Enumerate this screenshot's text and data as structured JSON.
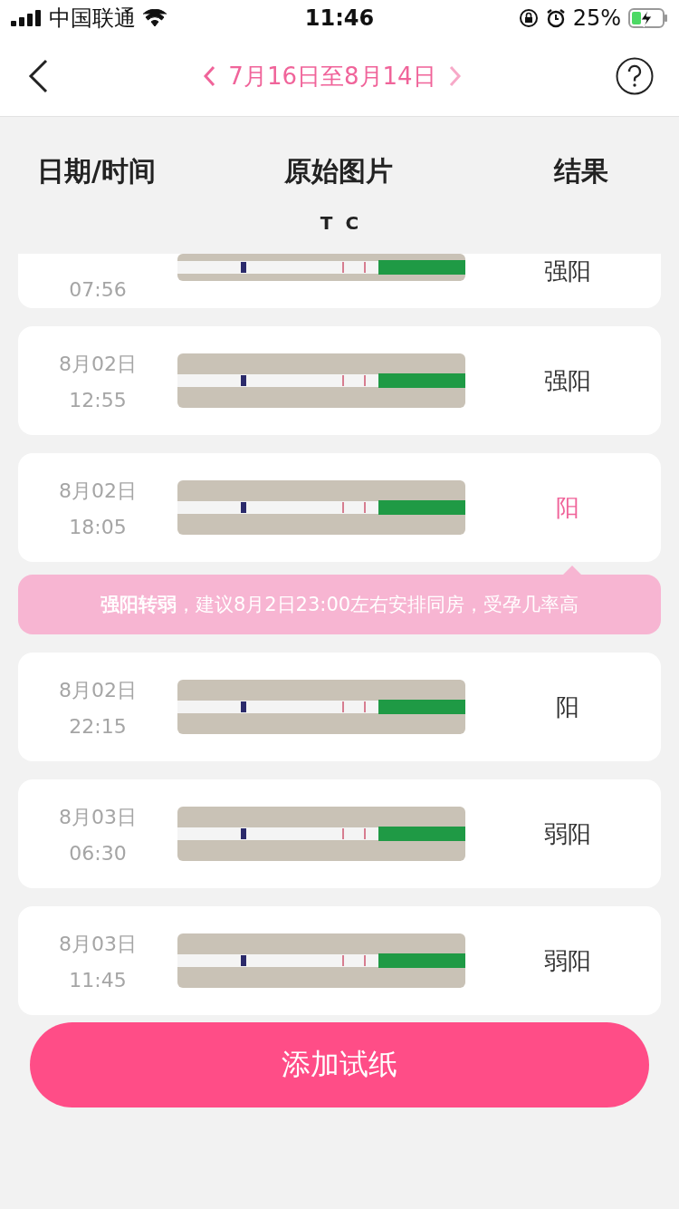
{
  "status_bar": {
    "carrier": "中国联通",
    "time": "11:46",
    "battery": "25%"
  },
  "header": {
    "range": "7月16日至8月14日"
  },
  "columns": [
    "日期/时间",
    "原始图片",
    "结果"
  ],
  "strip_marks": [
    "T",
    "C"
  ],
  "rows": [
    {
      "date": "",
      "time": "07:56",
      "result": "强阳",
      "highlighted": false,
      "partial": true
    },
    {
      "date": "8月02日",
      "time": "12:55",
      "result": "强阳",
      "highlighted": false,
      "partial": false
    },
    {
      "date": "8月02日",
      "time": "18:05",
      "result": "阳",
      "highlighted": true,
      "partial": false,
      "tip": "**强阳转弱**，建议8月2日23:00左右安排同房，受孕几率高"
    },
    {
      "date": "8月02日",
      "time": "22:15",
      "result": "阳",
      "highlighted": false,
      "partial": false
    },
    {
      "date": "8月03日",
      "time": "06:30",
      "result": "弱阳",
      "highlighted": false,
      "partial": false
    },
    {
      "date": "8月03日",
      "time": "11:45",
      "result": "弱阳",
      "highlighted": false,
      "partial": false
    }
  ],
  "add_button": "添加试纸"
}
